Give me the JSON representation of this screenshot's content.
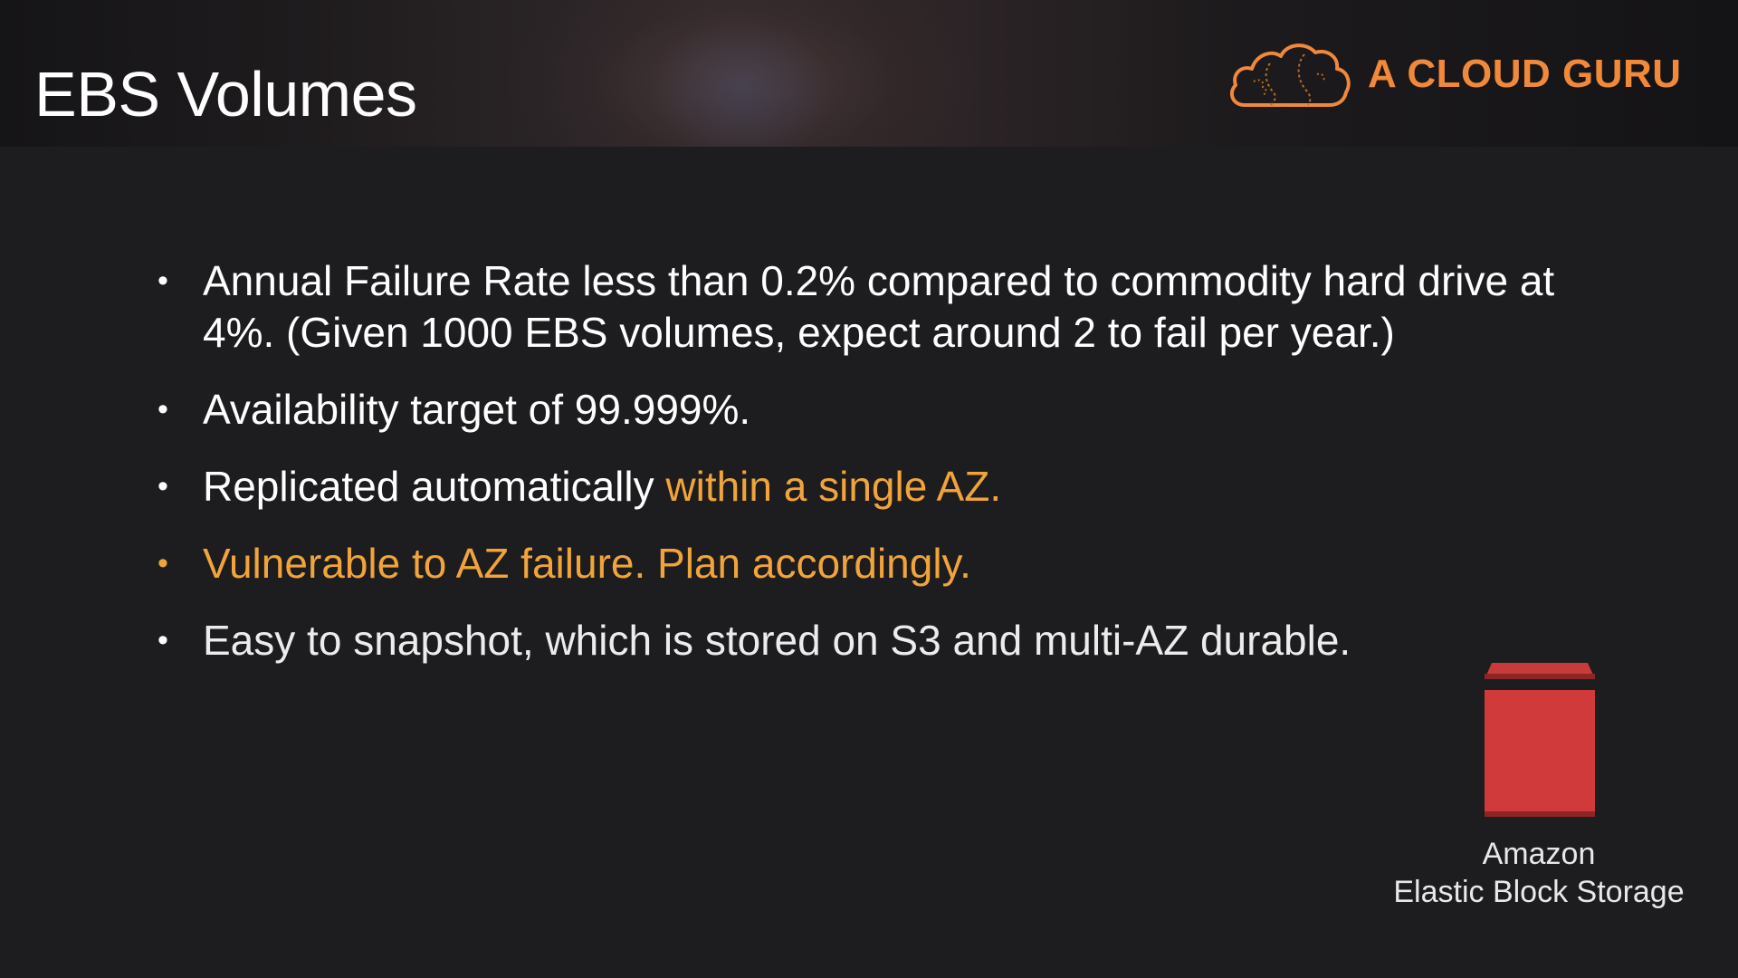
{
  "slide": {
    "title": "EBS Volumes",
    "logo_text": "A CLOUD GURU",
    "logo_icon": "cloud-icon",
    "accent_color": "#f0a43a",
    "logo_color": "#f0893a",
    "bullets": [
      {
        "text": "Annual Failure Rate less than 0.2% compared to commodity hard drive at 4%.  (Given 1000 EBS volumes, expect around 2 to fail per year.)"
      },
      {
        "text": "Availability target of 99.999%."
      },
      {
        "text_plain": "Replicated automatically ",
        "text_highlight": "within a single AZ."
      },
      {
        "text": "Vulnerable to AZ failure.  Plan accordingly."
      },
      {
        "text": "Easy to snapshot, which is stored on S3 and multi-AZ durable."
      }
    ],
    "bullet_glyph": "•",
    "service_icon": "ebs-volume-icon",
    "service_color": "#d13a3a",
    "service_label_line1": "Amazon",
    "service_label_line2": "Elastic Block Storage"
  }
}
